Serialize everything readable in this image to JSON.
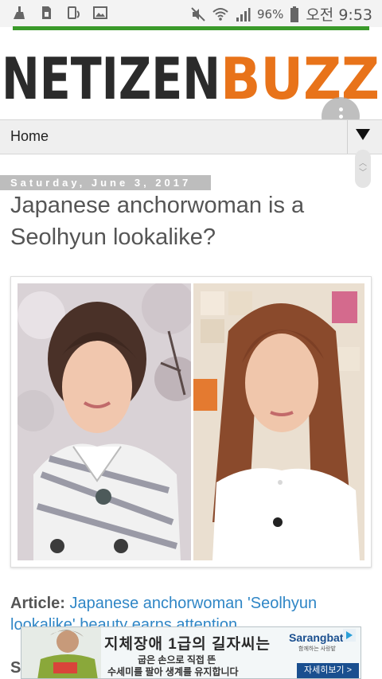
{
  "status_bar": {
    "icons_left": [
      "cleaner-icon",
      "sim-card-icon",
      "screen-rotate-icon",
      "gallery-icon"
    ],
    "icons_right": [
      "mute-icon",
      "wifi-icon",
      "signal-icon",
      "battery-icon"
    ],
    "battery_percent": "96%",
    "time": "오전 9:53"
  },
  "site": {
    "logo_part1": "NETIZEN",
    "logo_part2": "BUZZ",
    "logo_colors": {
      "part1": "#2b2b2b",
      "part2": "#e8731a"
    },
    "accent_line_color": "#3a9a2a"
  },
  "nav": {
    "home_label": "Home"
  },
  "post": {
    "date": "Saturday, June 3, 2017",
    "title": "Japanese anchorwoman is a Seolhyun lookalike?",
    "article_label": "Article:",
    "article_link": "Japanese anchorwoman 'Seolhyun lookalike' beauty earns attention",
    "next_partial": "S"
  },
  "ad": {
    "headline": "지체장애 1급의 길자씨는",
    "subline1": "굽은 손으로 직접 뜬",
    "subline2": "수세미를 팔아 생계를 유지합니다",
    "brand": "Sarangbat",
    "brand_sub": "함께하는 사랑밭",
    "cta": "자세히보기 >"
  }
}
